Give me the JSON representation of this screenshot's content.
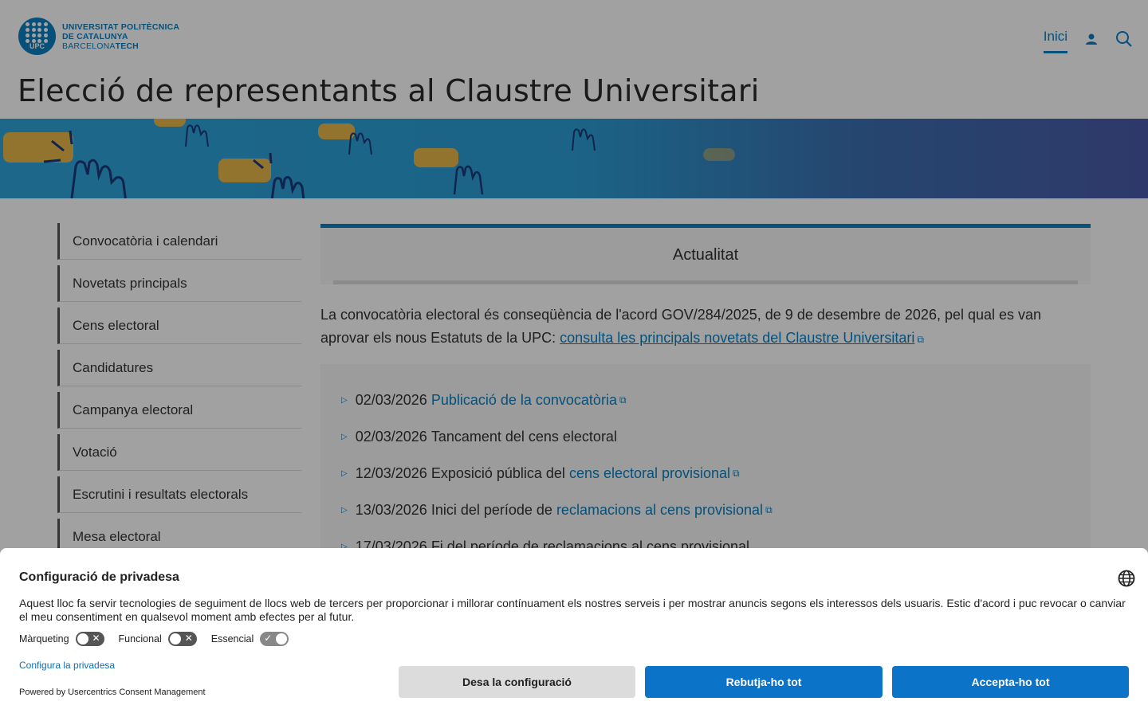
{
  "header": {
    "logo_line1": "UNIVERSITAT POLITÈCNICA",
    "logo_line2": "DE CATALUNYA",
    "logo_line3a": "BARCELONA",
    "logo_line3b": "TECH",
    "logo_badge": "UPC",
    "nav_home": "Inici",
    "user_icon": "user-icon",
    "search_icon": "search-icon"
  },
  "page": {
    "title": "Elecció de representants al Claustre Universitari"
  },
  "sidebar": {
    "items": [
      {
        "label": "Convocatòria i calendari"
      },
      {
        "label": "Novetats principals"
      },
      {
        "label": "Cens electoral"
      },
      {
        "label": "Candidatures"
      },
      {
        "label": "Campanya electoral"
      },
      {
        "label": "Votació"
      },
      {
        "label": "Escrutini i resultats electorals"
      },
      {
        "label": "Mesa electoral"
      }
    ]
  },
  "main": {
    "section_title": "Actualitat",
    "intro_text": " La convocatòria electoral és conseqüència de l'acord GOV/284/2025, de 9 de desembre de 2026, pel qual es van aprovar els nous Estatuts de la UPC: ",
    "intro_link": "consulta les principals novetats del Claustre Universitari",
    "events": [
      {
        "date": "02/03/2026",
        "text": "",
        "link": "Publicació de la convocatòria"
      },
      {
        "date": "02/03/2026",
        "text": "Tancament del cens electoral",
        "link": ""
      },
      {
        "date": "12/03/2026",
        "text": "Exposició pública del",
        "link": "cens electoral provisional"
      },
      {
        "date": "13/03/2026",
        "text": "Inici del període de",
        "link": "reclamacions al cens provisional"
      },
      {
        "date": "17/03/2026",
        "text": "Fi del període de reclamacions al cens provisional",
        "link": ""
      }
    ]
  },
  "consent": {
    "title": "Configuració de privadesa",
    "text": "Aquest lloc fa servir tecnologies de seguiment de llocs web de tercers per proporcionar i millorar contínuament els nostres serveis i per mostrar anuncis segons els interessos dels usuaris. Estic d'acord i puc revocar o canviar el meu consentiment en qualsevol moment amb efectes per al futur.",
    "toggles": [
      {
        "label": "Màrqueting",
        "on": false
      },
      {
        "label": "Funcional",
        "on": false
      },
      {
        "label": "Essencial",
        "on": true
      }
    ],
    "configure_link": "Configura la privadesa",
    "powered": "Powered by Usercentrics Consent Management",
    "btn_save": "Desa la configuració",
    "btn_deny": "Rebutja-ho tot",
    "btn_accept": "Accepta-ho tot",
    "language_icon": "globe-icon"
  },
  "colors": {
    "accent": "#0b7fc1",
    "button": "#0b73c8"
  }
}
